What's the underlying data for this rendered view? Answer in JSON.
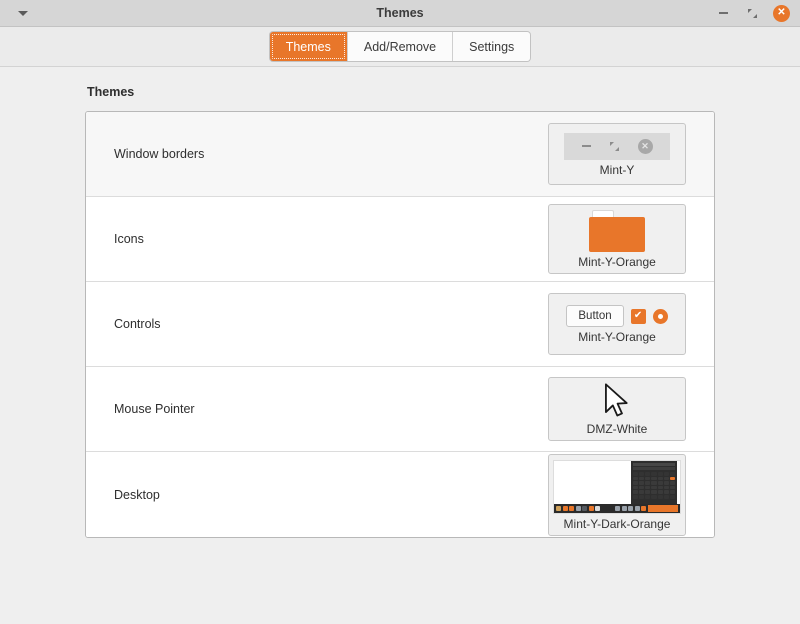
{
  "window": {
    "title": "Themes",
    "menu_icon": "chevron-down-icon",
    "minimize_label": "",
    "maximize_label": "",
    "close_label": "✕"
  },
  "toolbar": {
    "tabs": [
      {
        "label": "Themes",
        "active": true
      },
      {
        "label": "Add/Remove",
        "active": false
      },
      {
        "label": "Settings",
        "active": false
      }
    ]
  },
  "main": {
    "section_title": "Themes",
    "rows": [
      {
        "label": "Window borders",
        "value": "Mint-Y"
      },
      {
        "label": "Icons",
        "value": "Mint-Y-Orange"
      },
      {
        "label": "Controls",
        "value": "Mint-Y-Orange"
      },
      {
        "label": "Mouse Pointer",
        "value": "DMZ-White"
      },
      {
        "label": "Desktop",
        "value": "Mint-Y-Dark-Orange"
      }
    ],
    "controls_preview": {
      "button_label": "Button",
      "checkbox_glyph": "✔",
      "radio_glyph": "●"
    },
    "window_borders_preview": {
      "close_glyph": "✕"
    }
  },
  "colors": {
    "accent_orange": "#e8762a",
    "titlebar_bg": "#d6d6d6",
    "toolbar_bg": "#ebebeb",
    "content_bg": "#efefef",
    "row_bg": "#ffffff",
    "row_selected_bg": "#f7f7f7"
  }
}
